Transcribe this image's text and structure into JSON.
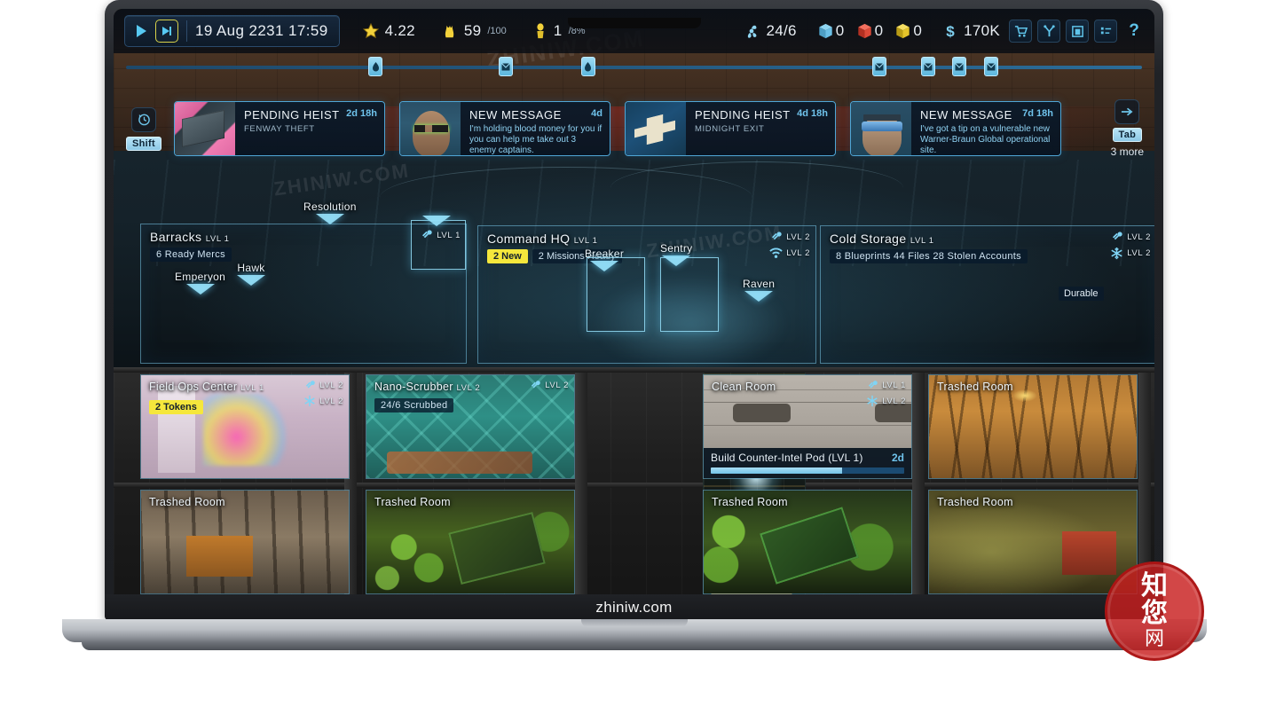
{
  "chin": {
    "label": "zhiniw.com"
  },
  "topbar": {
    "play_icon": "play-icon",
    "fast_forward_icon": "fast-forward-icon",
    "date": "19 Aug 2231 17:59",
    "resources": [
      {
        "icon": "star-icon",
        "name": "rating",
        "value": "4.22"
      },
      {
        "icon": "flame-icon",
        "name": "heat",
        "value": "59",
        "sub": "/100"
      },
      {
        "icon": "informant-icon",
        "name": "informants",
        "value": "1",
        "sub": "/8%"
      }
    ],
    "right_resources": [
      {
        "icon": "mercs-icon",
        "name": "mercs",
        "value": "24/6"
      }
    ],
    "cubes": [
      {
        "icon": "cube-blue-icon",
        "name": "blue-crate",
        "value": "0",
        "color": "#58b6e0"
      },
      {
        "icon": "cube-red-icon",
        "name": "red-crate",
        "value": "0",
        "color": "#e44a3c"
      },
      {
        "icon": "cube-yellow-icon",
        "name": "yellow-crate",
        "value": "0",
        "color": "#e9c82a"
      }
    ],
    "money": {
      "icon": "dollar-icon",
      "name": "money",
      "value": "170K"
    },
    "buttons": [
      {
        "icon": "shopping-cart-icon",
        "name": "market-button"
      },
      {
        "icon": "upgrade-tree-icon",
        "name": "upgrades-button"
      },
      {
        "icon": "codex-book-icon",
        "name": "codex-button"
      },
      {
        "icon": "log-list-icon",
        "name": "log-button"
      },
      {
        "icon": "help-question-icon",
        "name": "help-button",
        "label": "?"
      }
    ]
  },
  "timeline": {
    "markers": [
      {
        "icon": "heist-marker-icon",
        "left_pct": 24.5
      },
      {
        "icon": "message-marker-icon",
        "left_pct": 37.0
      },
      {
        "icon": "heist-marker-icon",
        "left_pct": 44.9
      },
      {
        "icon": "message-marker-icon",
        "left_pct": 72.9
      },
      {
        "icon": "message-marker-icon",
        "left_pct": 77.6
      },
      {
        "icon": "message-marker-icon",
        "left_pct": 80.6
      },
      {
        "icon": "message-marker-icon",
        "left_pct": 83.6
      }
    ]
  },
  "notifications": {
    "history_icon": "history-clock-icon",
    "shift_key": "Shift",
    "next_key": "Tab",
    "next_icon": "arrow-right-icon",
    "more_label": "3 more",
    "cards": [
      {
        "thumb": "heist-map-thumb",
        "title": "PENDING HEIST",
        "subtitle": "FENWAY THEFT",
        "time": "2d 18h",
        "message": ""
      },
      {
        "thumb": "merc-portrait-thumb",
        "title": "NEW MESSAGE",
        "subtitle": "",
        "time": "4d",
        "message": "I'm holding blood money for you if you can help me take out 3 enemy captains."
      },
      {
        "thumb": "heist-blueprint-thumb",
        "title": "PENDING HEIST",
        "subtitle": "MIDNIGHT EXIT",
        "time": "4d 18h",
        "message": ""
      },
      {
        "thumb": "informant-portrait-thumb",
        "title": "NEW MESSAGE",
        "subtitle": "",
        "time": "7d 18h",
        "message": "I've got a tip on a vulnerable new Warner-Braun Global operational site."
      }
    ]
  },
  "floor_label": {
    "name": "Resolution"
  },
  "rooms": [
    {
      "name": "Barracks",
      "level": "LVL 1",
      "stat": "6 Ready Mercs",
      "badge": "",
      "corner": [
        {
          "icon": "power-plug-icon",
          "level": "LVL 1"
        }
      ],
      "units": [
        {
          "name": "Emperyon"
        },
        {
          "name": "Hawk"
        }
      ]
    },
    {
      "name": "Command HQ",
      "level": "LVL 1",
      "stat": "2 Missions Ready",
      "badge": "2 New",
      "corner": [
        {
          "icon": "power-plug-icon",
          "level": "LVL 2"
        },
        {
          "icon": "wifi-icon",
          "level": "LVL 2"
        }
      ],
      "units": [
        {
          "name": "Breaker"
        },
        {
          "name": "Sentry"
        },
        {
          "name": "Raven"
        }
      ]
    },
    {
      "name": "Cold Storage",
      "level": "LVL 1",
      "stat": "8 Blueprints   44 Files   28 Stolen Accounts",
      "badge": "",
      "corner": [
        {
          "icon": "power-plug-icon",
          "level": "LVL 2"
        },
        {
          "icon": "snowflake-icon",
          "level": "LVL 2"
        }
      ],
      "tag": "Durable",
      "units": []
    }
  ],
  "grid": {
    "row1": [
      {
        "name": "Field Ops Center",
        "level": "LVL 1",
        "badge": "2 Tokens",
        "art": "art-fieldops",
        "corner": [
          {
            "icon": "power-plug-icon",
            "level": "LVL 2"
          },
          {
            "icon": "snowflake-icon",
            "level": "LVL 2"
          }
        ]
      },
      {
        "name": "Nano-Scrubber",
        "level": "LVL 2",
        "stat": "24/6 Scrubbed",
        "art": "art-nano",
        "corner": [
          {
            "icon": "power-plug-icon",
            "level": "LVL 2"
          }
        ]
      },
      {
        "name": "Clean Room",
        "level": "",
        "art": "art-clean",
        "corner": [
          {
            "icon": "power-plug-icon",
            "level": "LVL 1"
          },
          {
            "icon": "snowflake-icon",
            "level": "LVL 2"
          }
        ],
        "build": {
          "label": "Build Counter-Intel Pod (LVL 1)",
          "time": "2d",
          "progress": 68
        }
      },
      {
        "name": "Trashed Room",
        "art": "art-trash-orange",
        "corner": []
      }
    ],
    "row2": [
      {
        "name": "Trashed Room",
        "art": "art-trash-grey",
        "corner": []
      },
      {
        "name": "Trashed Room",
        "art": "art-trash-green",
        "corner": []
      },
      {
        "name": "Trashed Room",
        "art": "art-trash-green2",
        "corner": []
      },
      {
        "name": "Trashed Room",
        "art": "art-trash-yellow",
        "corner": []
      }
    ]
  },
  "seal": {
    "l1": "知",
    "l2": "您",
    "l3": "网"
  },
  "watermarks": [
    "ZHINIW.COM",
    "ZHINIW.COM",
    "ZHINIW.COM",
    "ZHINIW.COM"
  ]
}
